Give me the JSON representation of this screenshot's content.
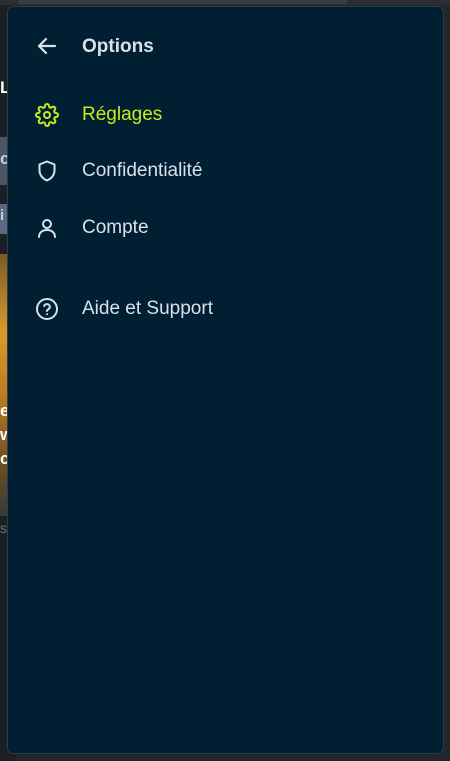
{
  "panel": {
    "title": "Options",
    "back_icon": "arrow-left-icon"
  },
  "menu": {
    "items": [
      {
        "label": "Réglages",
        "icon": "gear-icon",
        "active": true
      },
      {
        "label": "Confidentialité",
        "icon": "shield-icon",
        "active": false
      },
      {
        "label": "Compte",
        "icon": "user-icon",
        "active": false
      },
      {
        "label": "Aide et Support",
        "icon": "help-circle-icon",
        "active": false
      }
    ]
  },
  "colors": {
    "panel_background": "#001f33",
    "active_accent": "#c6ea1c",
    "text": "#d9e1e8"
  },
  "background_page": {
    "letters": [
      "L",
      "c",
      "i",
      "e",
      "w",
      "c",
      "s"
    ]
  }
}
